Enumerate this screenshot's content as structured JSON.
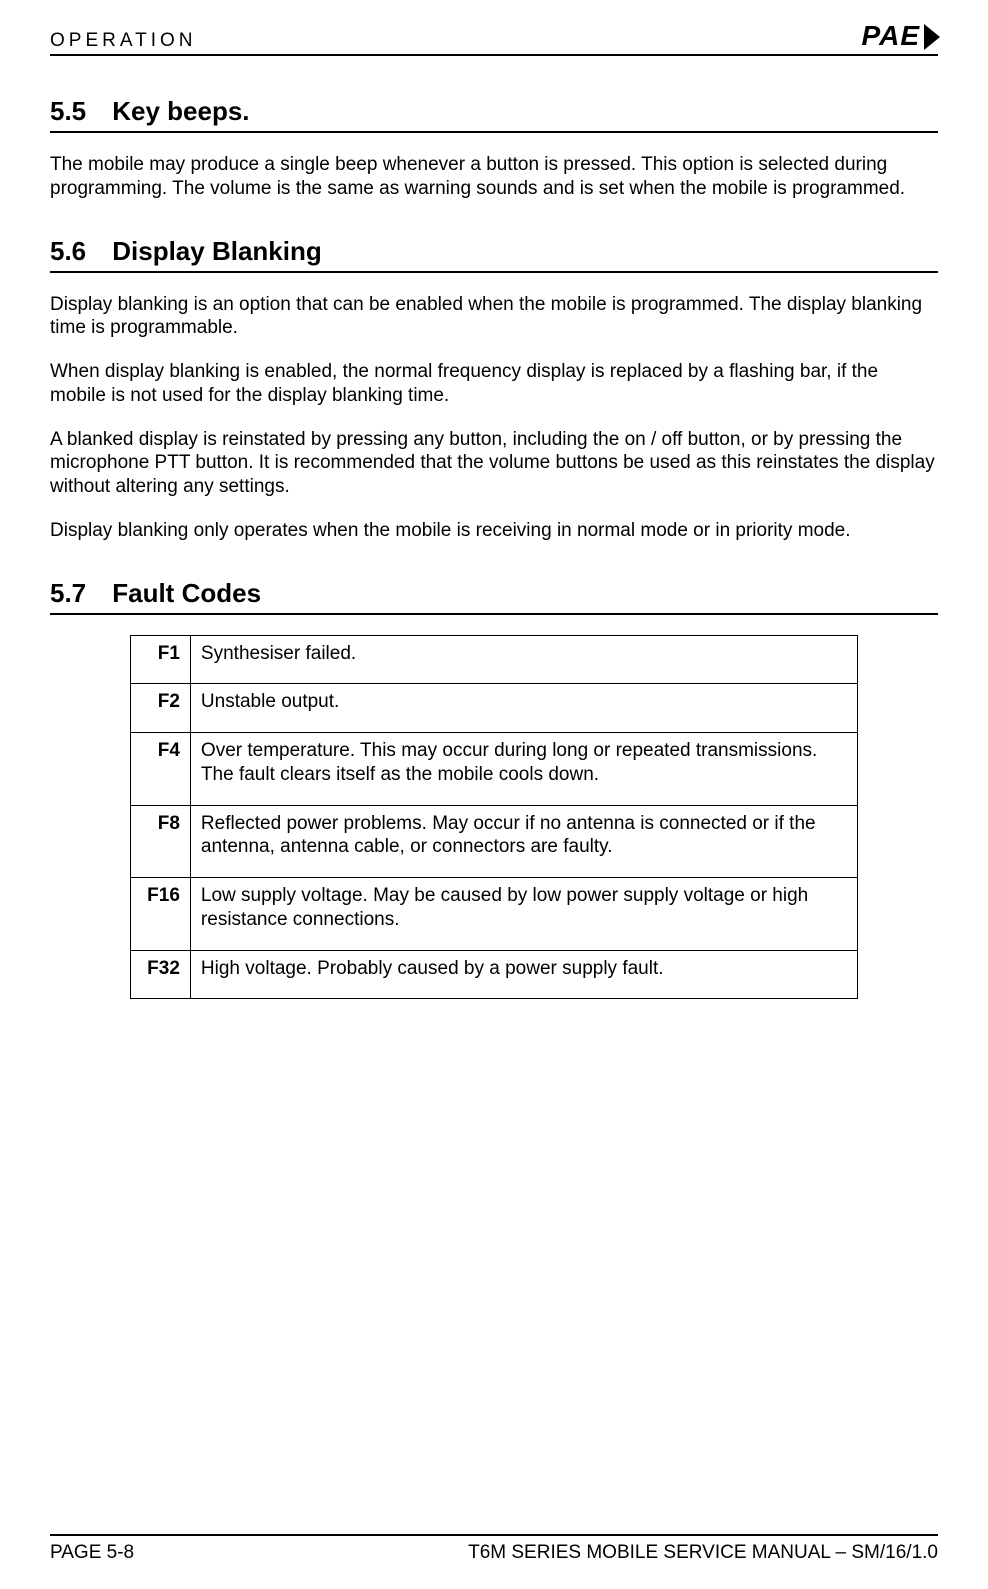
{
  "header": {
    "title": "OPERATION",
    "logo": "PAE"
  },
  "sections": {
    "s55": {
      "num": "5.5",
      "title": "Key beeps.",
      "p1": "The mobile may produce a single beep whenever a button is pressed.  This option is selected during programming.  The volume is the same as warning sounds and is set when the mobile is programmed."
    },
    "s56": {
      "num": "5.6",
      "title": "Display Blanking",
      "p1": "Display blanking is an option that can be enabled when the mobile is programmed.  The display blanking time is programmable.",
      "p2": "When display blanking is enabled, the normal frequency display is replaced by a flashing bar, if the mobile is not used for the display blanking time.",
      "p3": "A blanked display is reinstated by pressing any button, including the on / off button, or by pressing the microphone PTT button.  It is recommended that the volume buttons be used as this reinstates the display without altering any settings.",
      "p4": "Display blanking only operates when the mobile is receiving in normal mode or in priority mode."
    },
    "s57": {
      "num": "5.7",
      "title": "Fault Codes",
      "faults": [
        {
          "code": "F1",
          "desc": "Synthesiser failed."
        },
        {
          "code": "F2",
          "desc": "Unstable output."
        },
        {
          "code": "F4",
          "desc": "Over temperature.  This may occur during long or repeated transmissions.  The fault clears itself as the mobile cools down."
        },
        {
          "code": "F8",
          "desc": "Reflected power problems.  May occur if no antenna is connected or if the antenna, antenna cable, or connectors are faulty."
        },
        {
          "code": "F16",
          "desc": "Low supply voltage.  May be caused by low power supply voltage or high resistance connections."
        },
        {
          "code": "F32",
          "desc": "High voltage.  Probably caused by a power supply fault."
        }
      ]
    }
  },
  "footer": {
    "left": "PAGE 5-8",
    "right": "T6M SERIES MOBILE SERVICE MANUAL – SM/16/1.0"
  }
}
